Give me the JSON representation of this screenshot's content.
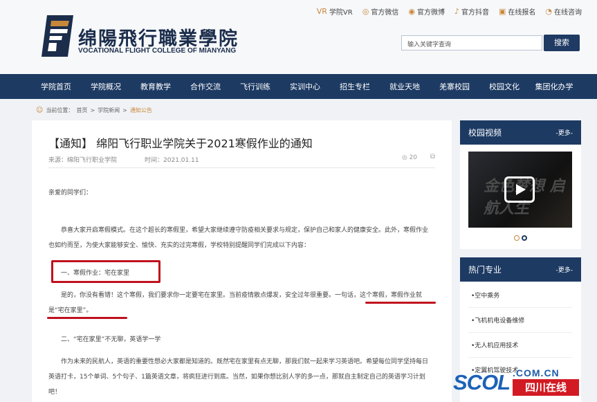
{
  "top_links": [
    {
      "label": "学院VR",
      "icon": "vr-icon",
      "glyph": "VR"
    },
    {
      "label": "官方微信",
      "icon": "wechat-icon",
      "glyph": "◎"
    },
    {
      "label": "官方微博",
      "icon": "weibo-icon",
      "glyph": "◉"
    },
    {
      "label": "官方抖音",
      "icon": "douyin-icon",
      "glyph": "♪"
    },
    {
      "label": "在线报名",
      "icon": "register-icon",
      "glyph": "▣"
    },
    {
      "label": "在线咨询",
      "icon": "consult-icon",
      "glyph": "◔"
    }
  ],
  "header": {
    "logo_cn": "绵陽飛行職業學院",
    "logo_en": "VOCATIONAL FLIGHT COLLEGE OF MIANYANG",
    "search_placeholder": "输入关键字查询",
    "search_button": "搜索"
  },
  "nav": [
    "学院首页",
    "学院概况",
    "教育教学",
    "合作交流",
    "飞行训练",
    "实训中心",
    "招生专栏",
    "就业天地",
    "羌寨校园",
    "校园文化",
    "集团化办学"
  ],
  "breadcrumb": {
    "prefix": "当前位置：",
    "home": "首页",
    "sep1": ">",
    "section": "学院新闻",
    "sep2": ">",
    "current": "通知公告"
  },
  "article": {
    "title": "【通知】 绵阳飞行职业学院关于2021寒假作业的通知",
    "source_label": "来源：",
    "source": "绵阳飞行职业学院",
    "time_label": "时间：",
    "time": "2021.01.11",
    "views": "20",
    "greeting": "亲爱的同学们：",
    "para1": "恭喜大家开启寒假模式。在这个超长的寒假里，希望大家继续遵守防疫相关要求与规定，保护自己和家人的健康安全。此外，寒假作业也如约而至，为使大家能够安全、愉快、充实的过完寒假，学校特别提醒同学们完成以下内容：",
    "section1": "一、寒假作业：宅在家里",
    "para2": "是的，你没有看错！这个寒假，我们要求你一定要宅在家里。当前疫情散点爆发，安全过年很重要。一句话，这个寒假，寒假作业就是“宅在家里”。",
    "section2": "二、“宅在家里”不无聊，英语学一学",
    "para3": "作为未来的民航人，英语的重要性想必大家都是知道的。既然宅在家里有点无聊，那我们就一起来学习英语吧。希望每位同学坚持每日英语打卡，15个单词、5个句子、1篇英语文章，将疯狂进行到底。当然，如果你想比别人学的多一点，那就自主制定自己的英语学习计划吧！"
  },
  "sidebar": {
    "video_title": "校园视频",
    "more": "-更多-",
    "video_overlay": "金色梦想 启航人生",
    "majors_title": "热门专业",
    "majors": [
      "•空中乘务",
      "•飞机机电设备维修",
      "•无人机应用技术",
      "•定翼机驾驶技术"
    ]
  },
  "watermark": {
    "domain": ".COM.CN",
    "brand": "SCOL",
    "site": "四川在线"
  },
  "colors": {
    "nav_bg": "#1d3a63",
    "accent": "#c8873a",
    "highlight_red": "#c0101d"
  }
}
